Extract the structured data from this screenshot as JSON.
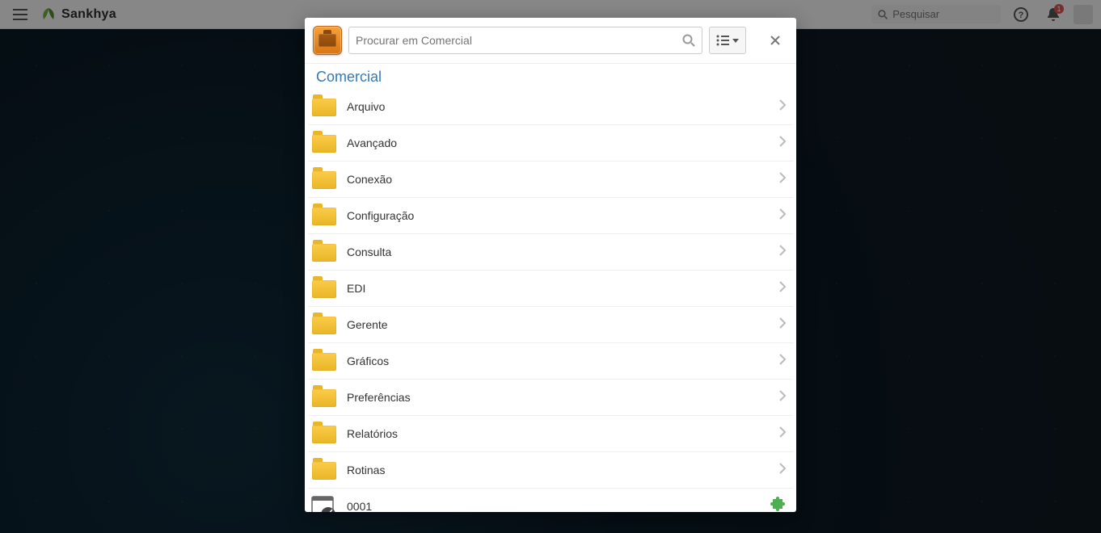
{
  "topbar": {
    "brand": "Sankhya",
    "search_placeholder": "Pesquisar",
    "notifications_count": "1"
  },
  "modal": {
    "search_placeholder": "Procurar em Comercial",
    "breadcrumb": "Comercial",
    "items": [
      {
        "type": "folder",
        "label": "Arquivo"
      },
      {
        "type": "folder",
        "label": "Avançado"
      },
      {
        "type": "folder",
        "label": "Conexão"
      },
      {
        "type": "folder",
        "label": "Configuração"
      },
      {
        "type": "folder",
        "label": "Consulta"
      },
      {
        "type": "folder",
        "label": "EDI"
      },
      {
        "type": "folder",
        "label": "Gerente"
      },
      {
        "type": "folder",
        "label": "Gráficos"
      },
      {
        "type": "folder",
        "label": "Preferências"
      },
      {
        "type": "folder",
        "label": "Relatórios"
      },
      {
        "type": "folder",
        "label": "Rotinas"
      },
      {
        "type": "dash",
        "label": "0001"
      }
    ]
  }
}
